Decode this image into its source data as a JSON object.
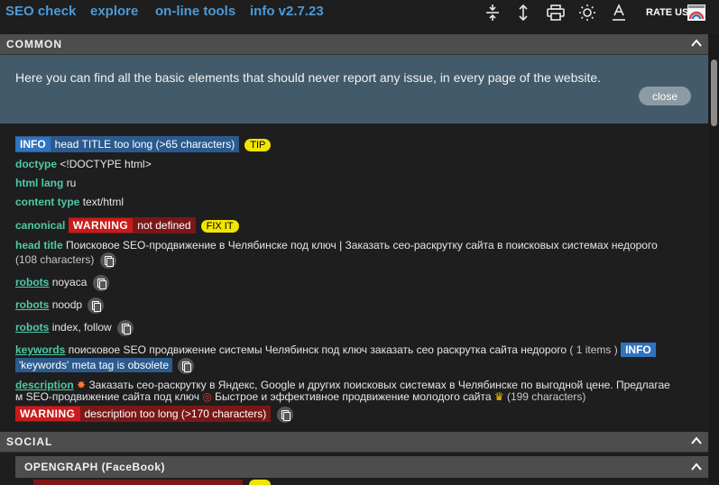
{
  "nav": {
    "seo_check": "SEO check",
    "explore": "explore",
    "online_tools": "on-line tools",
    "info": "info v2.7.23"
  },
  "toolbar": {
    "icons": [
      "collapse-all-icon",
      "expand-all-icon",
      "print-icon",
      "brightness-icon",
      "text-format-icon"
    ],
    "rate_label": "RATE US"
  },
  "sections": {
    "common": "COMMON",
    "social": "SOCIAL",
    "opengraph": "OPENGRAPH (FaceBook)"
  },
  "info_panel": {
    "text": "Here you can find all the basic elements that should never report any issue, in every page of the website.",
    "close_label": "close"
  },
  "rows": {
    "title_info": {
      "badge": "INFO",
      "text": "head TITLE too long (>65 characters)",
      "tip": "TIP"
    },
    "doctype": {
      "key": "doctype",
      "value": "<!DOCTYPE html>"
    },
    "html_lang": {
      "key": "html lang",
      "value": "ru"
    },
    "content_type": {
      "key": "content type",
      "value": "text/html"
    },
    "canonical": {
      "key": "canonical",
      "badge": "WARNING",
      "text": "not defined",
      "fix": "FIX IT"
    },
    "head_title": {
      "key": "head title",
      "value": "Поисковое SEO-продвижение в Челябинске под ключ | Заказать сео-раскрутку сайта в поисковых системах недорого",
      "count": "(108 characters)"
    },
    "robots1": {
      "key": "robots",
      "value": "noyaca"
    },
    "robots2": {
      "key": "robots",
      "value": "noodp"
    },
    "robots3": {
      "key": "robots",
      "value": "index, follow"
    },
    "keywords": {
      "key": "keywords",
      "value": "поисковое SEO продвижение системы Челябинск под ключ заказать сео раскрутка сайта недорого",
      "count": "( 1 items )",
      "badge": "INFO",
      "obsolete": "'keywords' meta tag is obsolete"
    },
    "description": {
      "key": "description",
      "line1": "Заказать сео-раскрутку в Яндекс, Google и других поисковых системах в Челябинске по выгодной цене. Предлагае",
      "line2a": "м SEO-продвижение сайта под ключ",
      "line2b": "Быстрое и эффективное продвижение молодого сайта",
      "count": "(199 characters)",
      "badge": "WARNING",
      "warning_text": "description too long (>170 characters)"
    }
  },
  "colors": {
    "nav_link": "#4e9ad6",
    "key_green": "#4ec9a8",
    "info_blue": "#2f74c0",
    "warning_red": "#c91b1b",
    "tip_yellow": "#f2e500",
    "panel_bg": "#425a69"
  }
}
